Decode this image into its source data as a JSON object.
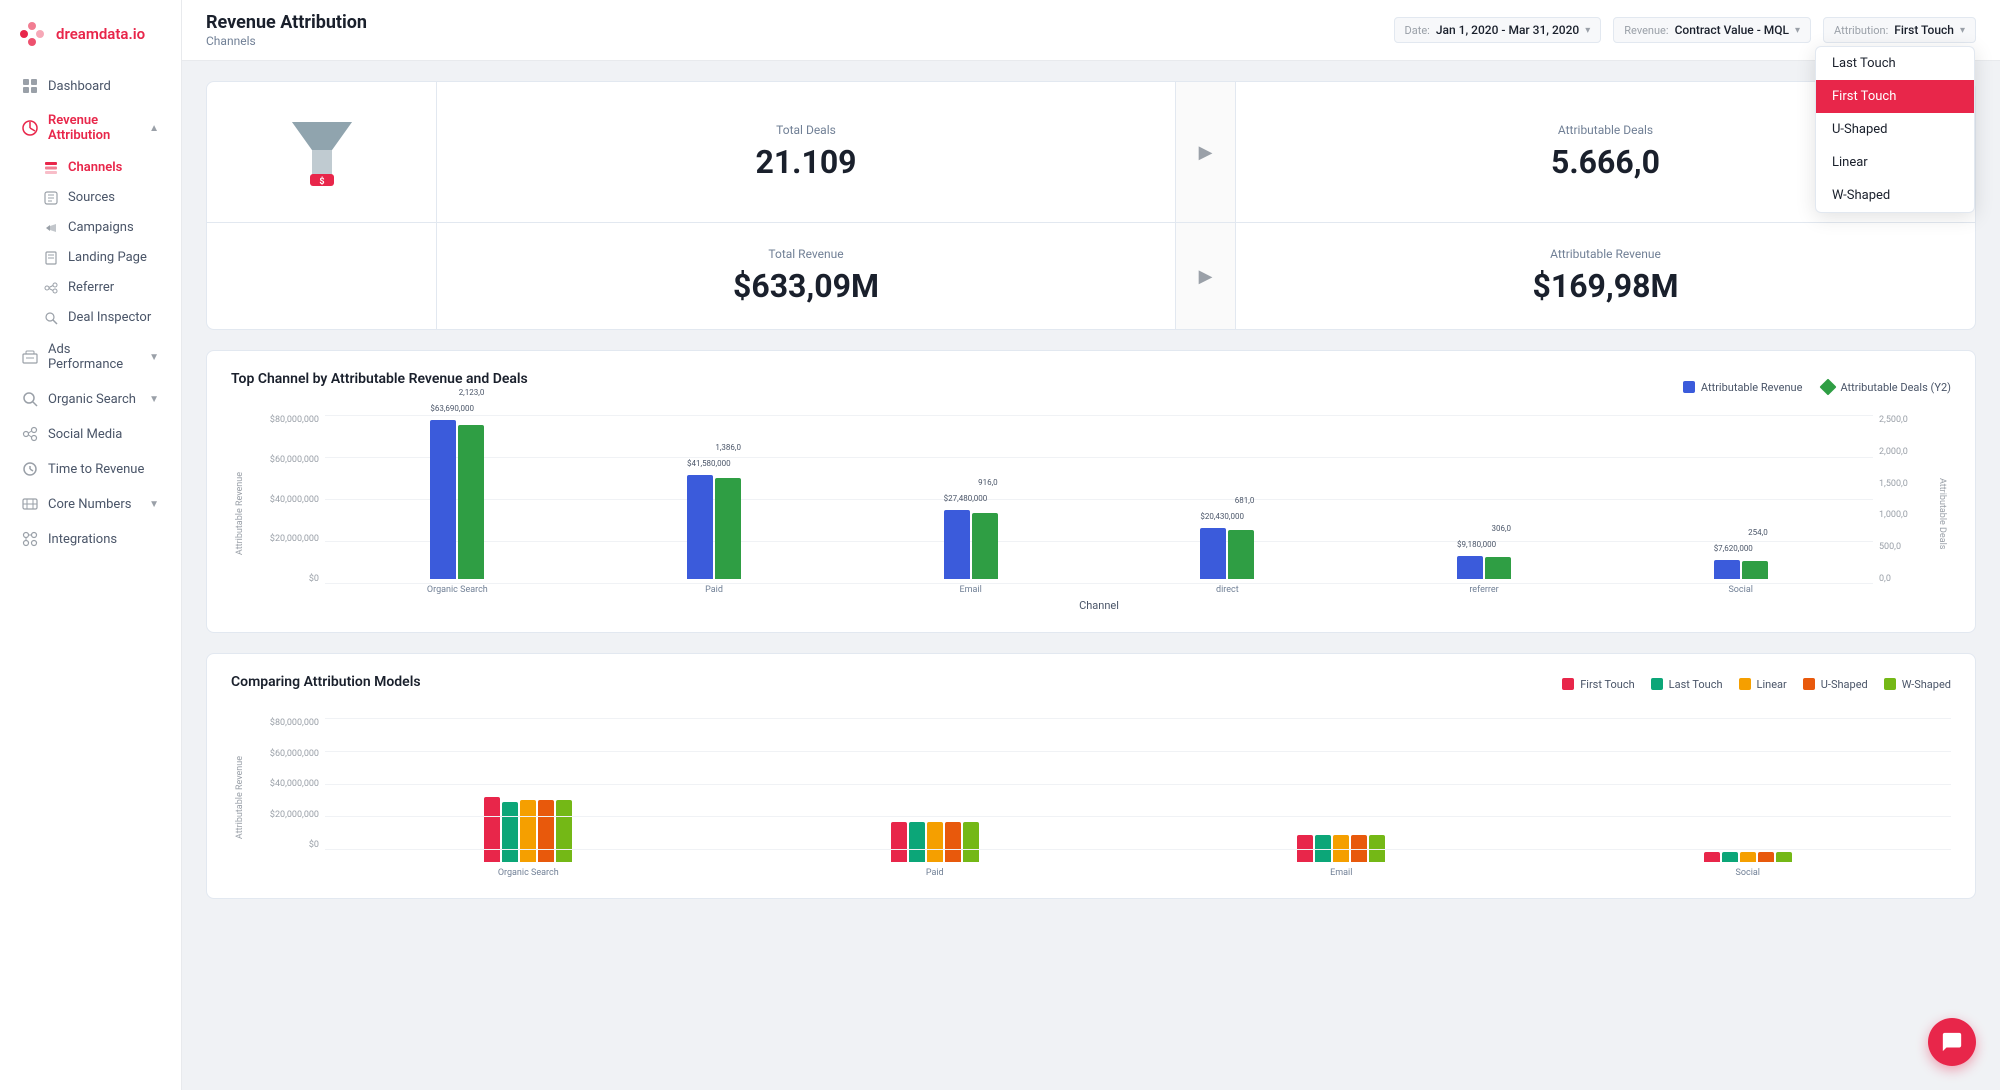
{
  "brand": {
    "name": "dreamdata.io",
    "logo_text": "dreamdata.io"
  },
  "sidebar": {
    "items": [
      {
        "id": "dashboard",
        "label": "Dashboard",
        "icon": "grid"
      },
      {
        "id": "revenue-attribution",
        "label": "Revenue Attribution",
        "icon": "chart-bar",
        "active": true,
        "expanded": true
      },
      {
        "id": "channels",
        "label": "Channels",
        "icon": "layers",
        "sub": true,
        "active": true
      },
      {
        "id": "sources",
        "label": "Sources",
        "icon": "source",
        "sub": true
      },
      {
        "id": "campaigns",
        "label": "Campaigns",
        "icon": "campaign",
        "sub": true
      },
      {
        "id": "landing-page",
        "label": "Landing Page",
        "icon": "page",
        "sub": true
      },
      {
        "id": "referrer",
        "label": "Referrer",
        "icon": "referrer",
        "sub": true
      },
      {
        "id": "deal-inspector",
        "label": "Deal Inspector",
        "icon": "inspector",
        "sub": true
      },
      {
        "id": "ads-performance",
        "label": "Ads Performance",
        "icon": "ads",
        "chevron": true
      },
      {
        "id": "organic-search",
        "label": "Organic Search",
        "icon": "search",
        "chevron": true
      },
      {
        "id": "social-media",
        "label": "Social Media",
        "icon": "social"
      },
      {
        "id": "time-to-revenue",
        "label": "Time to Revenue",
        "icon": "time"
      },
      {
        "id": "core-numbers",
        "label": "Core Numbers",
        "icon": "numbers",
        "chevron": true
      },
      {
        "id": "integrations",
        "label": "Integrations",
        "icon": "integrations"
      }
    ]
  },
  "header": {
    "title": "Revenue Attribution",
    "subtitle": "Channels",
    "date_label": "Date:",
    "date_value": "Jan 1, 2020 - Mar 31, 2020",
    "revenue_label": "Revenue:",
    "revenue_value": "Contract Value - MQL",
    "attribution_label": "Attribution:",
    "attribution_value": "First Touch"
  },
  "attribution_dropdown": {
    "options": [
      {
        "id": "last-touch",
        "label": "Last Touch"
      },
      {
        "id": "first-touch",
        "label": "First Touch",
        "selected": true
      },
      {
        "id": "u-shaped",
        "label": "U-Shaped"
      },
      {
        "id": "linear",
        "label": "Linear"
      },
      {
        "id": "w-shaped",
        "label": "W-Shaped"
      }
    ]
  },
  "stats": {
    "total_deals_label": "Total Deals",
    "total_deals_value": "21.109",
    "attributable_deals_label": "Attributable Deals",
    "attributable_deals_value": "5.666,0",
    "total_revenue_label": "Total Revenue",
    "total_revenue_value": "$633,09M",
    "attributable_revenue_label": "Attributable Revenue",
    "attributable_revenue_value": "$169,98M"
  },
  "chart1": {
    "title": "Top Channel by Attributable Revenue and Deals",
    "legend_revenue": "Attributable Revenue",
    "legend_deals": "Attributable Deals (Y2)",
    "y_axis": [
      "$80,000,000",
      "$60,000,000",
      "$40,000,000",
      "$20,000,000",
      "$0"
    ],
    "y_axis_right": [
      "2,500,0",
      "2,000,0",
      "1,500,0",
      "1,000,0",
      "500,0",
      "0,0"
    ],
    "x_label": "Channel",
    "y_label": "Attributable Revenue",
    "y_label_right": "Attributable Deals",
    "bars": [
      {
        "channel": "Organic Search",
        "revenue": "$63,690,000",
        "revenue_h": 159,
        "deals": "2,123,0",
        "deals_h": 154
      },
      {
        "channel": "Paid",
        "revenue": "$41,580,000",
        "revenue_h": 104,
        "deals": "1,386,0",
        "deals_h": 101
      },
      {
        "channel": "Email",
        "revenue": "$27,480,000",
        "revenue_h": 69,
        "deals": "916,0",
        "deals_h": 66
      },
      {
        "channel": "direct",
        "revenue": "$20,430,000",
        "revenue_h": 51,
        "deals": "681,0",
        "deals_h": 49
      },
      {
        "channel": "referrer",
        "revenue": "$9,180,000",
        "revenue_h": 23,
        "deals": "306,0",
        "deals_h": 22
      },
      {
        "channel": "Social",
        "revenue": "$7,620,000",
        "revenue_h": 19,
        "deals": "254,0",
        "deals_h": 18
      }
    ]
  },
  "chart2": {
    "title": "Comparing Attribution Models",
    "legend": [
      {
        "label": "First Touch",
        "color": "#e8264a"
      },
      {
        "label": "Last Touch",
        "color": "#0ca678"
      },
      {
        "label": "Linear",
        "color": "#f59f00"
      },
      {
        "label": "U-Shaped",
        "color": "#e8590c"
      },
      {
        "label": "W-Shaped",
        "color": "#74b816"
      }
    ],
    "y_axis": [
      "$80,000,000",
      "$60,000,000",
      "$40,000,000",
      "$20,000,000",
      "$0"
    ],
    "bars": [
      {
        "channel": "Organic Search",
        "heights": [
          65,
          62,
          62,
          62,
          62
        ]
      },
      {
        "channel": "Paid",
        "heights": [
          42,
          42,
          42,
          42,
          42
        ]
      },
      {
        "channel": "Email",
        "heights": [
          28,
          28,
          28,
          28,
          28
        ]
      },
      {
        "channel": "Social",
        "heights": [
          12,
          12,
          12,
          12,
          12
        ]
      }
    ]
  },
  "last_touch_linear": "Last Touch Linear",
  "chat_button": "💬"
}
